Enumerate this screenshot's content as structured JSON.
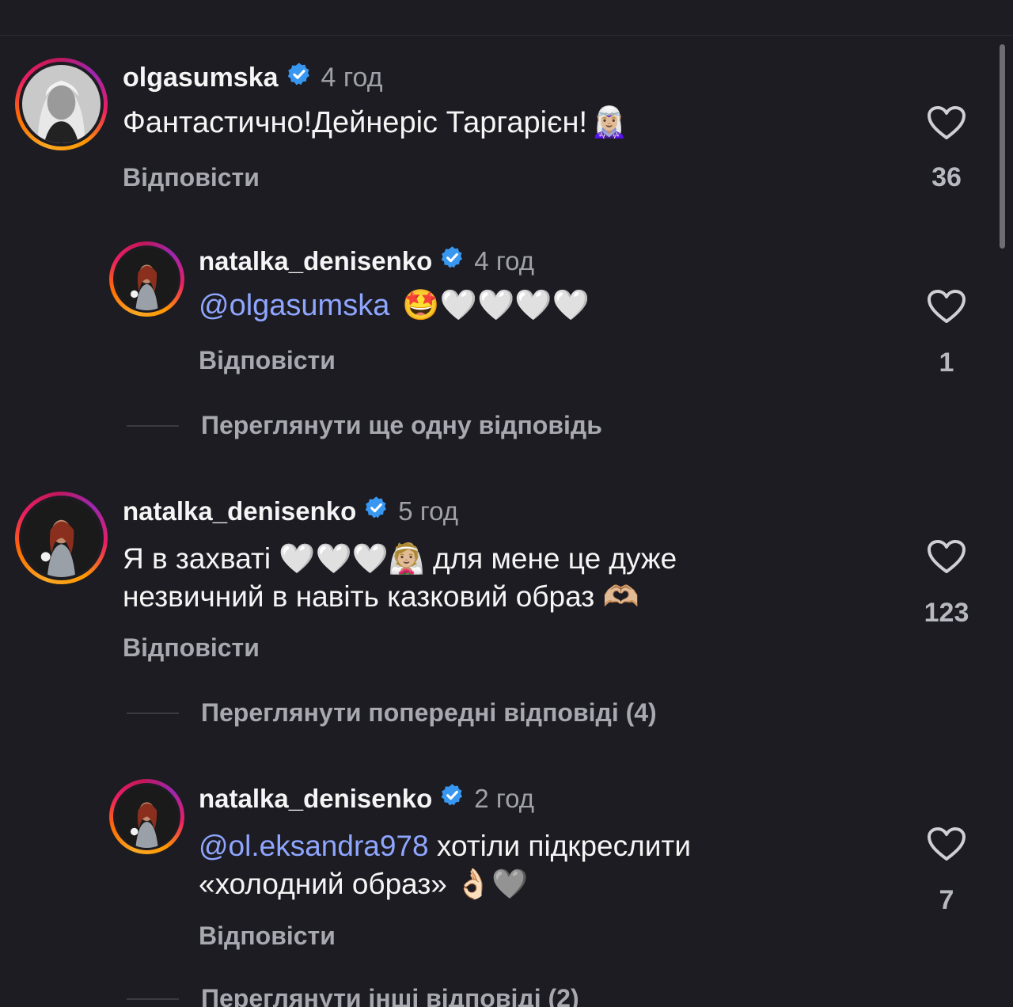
{
  "colors": {
    "background": "#1c1c22",
    "mention": "#8fa6ff",
    "verified": "#3897f0",
    "muted": "#a8a8b0"
  },
  "comments": [
    {
      "username": "olgasumska",
      "verified": true,
      "time": "4 год",
      "mention": "",
      "text": "Фантастично!Дейнеріс Таргарієн!",
      "emoji": "🧝🏼‍♀️",
      "reply_label": "Відповісти",
      "likes": "36",
      "avatar_icon": "avatar-blonde-woman"
    },
    {
      "username": "natalka_denisenko",
      "verified": true,
      "time": "4 год",
      "mention": "@olgasumska",
      "text": "",
      "emoji": "🤩🤍🤍🤍🤍",
      "reply_label": "Відповісти",
      "likes": "1",
      "avatar_icon": "avatar-woman-armor"
    },
    {
      "username": "natalka_denisenko",
      "verified": true,
      "time": "5 год",
      "line1": "Я в захваті 🤍🤍🤍👰🏼 для мене це дуже",
      "line2": "незвичний в навіть казковий образ 🫶🏼",
      "reply_label": "Відповісти",
      "likes": "123",
      "avatar_icon": "avatar-woman-armor"
    },
    {
      "username": "natalka_denisenko",
      "verified": true,
      "time": "2 год",
      "mention": "@ol.eksandra978",
      "line1_text": " хотіли підкреслити",
      "line2": "«холодний образ» 👌🏻🩶",
      "reply_label": "Відповісти",
      "likes": "7",
      "avatar_icon": "avatar-woman-armor"
    }
  ],
  "view_more": [
    "Переглянути ще одну відповідь",
    "Переглянути попередні відповіді (4)",
    "Переглянути інші відповіді (2)"
  ]
}
